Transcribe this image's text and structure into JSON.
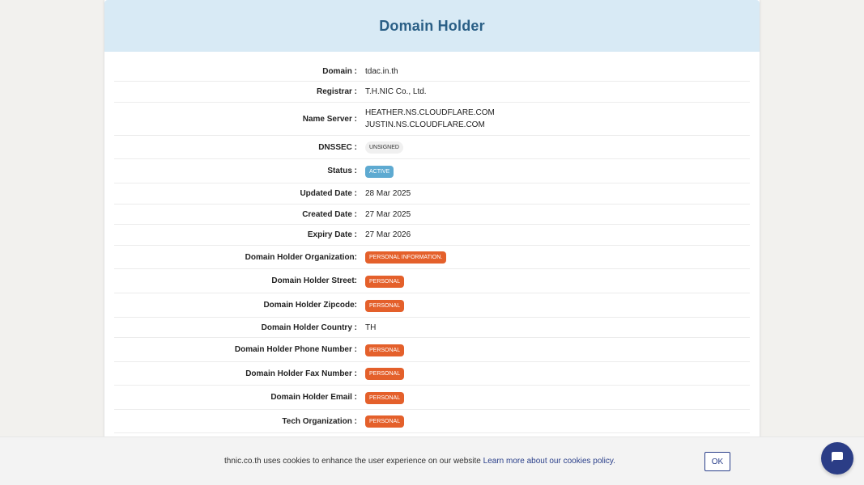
{
  "card": {
    "title": "Domain Holder"
  },
  "rows": [
    {
      "label": "Domain :",
      "value": "tdac.in.th",
      "type": "text"
    },
    {
      "label": "Registrar :",
      "value": "T.H.NIC Co., Ltd.",
      "type": "text"
    },
    {
      "label": "Name Server :",
      "lines": [
        "HEATHER.NS.CLOUDFLARE.COM",
        "JUSTIN.NS.CLOUDFLARE.COM"
      ],
      "type": "multi"
    },
    {
      "label": "DNSSEC :",
      "value": "UNSIGNED",
      "type": "badge",
      "badge_style": "gray"
    },
    {
      "label": "Status :",
      "value": "ACTIVE",
      "type": "badge",
      "badge_style": "blue"
    },
    {
      "label": "Updated Date :",
      "value": "28 Mar 2025",
      "type": "text"
    },
    {
      "label": "Created Date :",
      "value": "27 Mar 2025",
      "type": "text"
    },
    {
      "label": "Expiry Date :",
      "value": "27 Mar 2026",
      "type": "text"
    },
    {
      "label": "Domain Holder Organization:",
      "value": "PERSONAL INFORMATION.",
      "type": "badge",
      "badge_style": "orange"
    },
    {
      "label": "Domain Holder Street:",
      "value": "PERSONAL",
      "type": "badge",
      "badge_style": "orange"
    },
    {
      "label": "Domain Holder Zipcode:",
      "value": "PERSONAL",
      "type": "badge",
      "badge_style": "orange"
    },
    {
      "label": "Domain Holder Country :",
      "value": "TH",
      "type": "text"
    },
    {
      "label": "Domain Holder Phone Number :",
      "value": "PERSONAL",
      "type": "badge",
      "badge_style": "orange"
    },
    {
      "label": "Domain Holder Fax Number :",
      "value": "PERSONAL",
      "type": "badge",
      "badge_style": "orange"
    },
    {
      "label": "Domain Holder Email :",
      "value": "PERSONAL",
      "type": "badge",
      "badge_style": "orange"
    },
    {
      "label": "Tech Organization :",
      "value": "PERSONAL",
      "type": "badge",
      "badge_style": "orange"
    }
  ],
  "cookie": {
    "text": "thnic.co.th uses cookies to enhance the user experience on our website",
    "link": "Learn more about our cookies policy.",
    "ok_label": "OK"
  },
  "chat": {
    "icon": "chat-bubble-icon"
  },
  "colors": {
    "header_bg": "#d8eaf5",
    "title": "#2a5f86",
    "badge_orange": "#e4602b",
    "badge_blue": "#5eaad1",
    "brand_navy": "#2b3d86"
  }
}
